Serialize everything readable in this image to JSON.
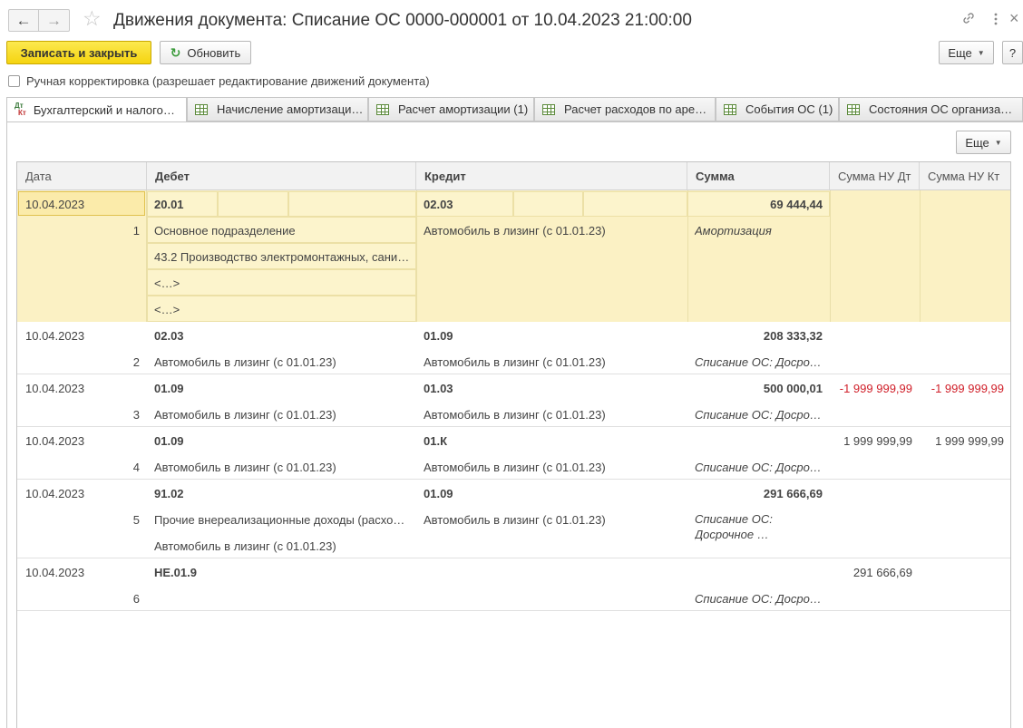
{
  "window": {
    "title": "Движения документа: Списание ОС 0000-000001 от 10.04.2023 21:00:00",
    "back_icon": "arrow-left",
    "forward_icon": "arrow-right",
    "favorite_icon": "star",
    "link_icon": "link",
    "more_icon": "vertical-ellipsis"
  },
  "toolbar": {
    "save_close_label": "Записать и закрыть",
    "refresh_label": "Обновить",
    "more_label": "Еще",
    "help_label": "?"
  },
  "manual_edit": {
    "label": "Ручная корректировка (разрешает редактирование движений документа)",
    "checked": false
  },
  "tabs": [
    {
      "label": "Бухгалтерский и налого…",
      "active": true
    },
    {
      "label": "Начисление амортизаци…"
    },
    {
      "label": "Расчет амортизации (1)"
    },
    {
      "label": "Расчет расходов по аре…"
    },
    {
      "label": "События ОС (1)"
    },
    {
      "label": "Состояния ОС организа…"
    }
  ],
  "panel": {
    "more_label": "Еще"
  },
  "grid": {
    "columns": [
      "Дата",
      "Дебет",
      "Кредит",
      "Сумма",
      "Сумма НУ Дт",
      "Сумма НУ Кт"
    ],
    "records": [
      {
        "date": "10.04.2023",
        "num": "1",
        "debit_account": "20.01",
        "debit_details": [
          "Основное подразделение",
          "43.2 Производство электромонтажных, сани…",
          "<…>",
          "<…>"
        ],
        "credit_account": "02.03",
        "credit_details": [
          "Автомобиль в лизинг (с 01.01.23)"
        ],
        "amount": "69 444,44",
        "content": "Амортизация",
        "nu_dt": "",
        "nu_kt": ""
      },
      {
        "date": "10.04.2023",
        "num": "2",
        "debit_account": "02.03",
        "debit_details": [
          "Автомобиль в лизинг (с 01.01.23)"
        ],
        "credit_account": "01.09",
        "credit_details": [
          "Автомобиль в лизинг (с 01.01.23)"
        ],
        "amount": "208 333,32",
        "content": "Списание ОС: Досро…",
        "nu_dt": "",
        "nu_kt": ""
      },
      {
        "date": "10.04.2023",
        "num": "3",
        "debit_account": "01.09",
        "debit_details": [
          "Автомобиль в лизинг (с 01.01.23)"
        ],
        "credit_account": "01.03",
        "credit_details": [
          "Автомобиль в лизинг (с 01.01.23)"
        ],
        "amount": "500 000,01",
        "content": "Списание ОС: Досро…",
        "nu_dt": "-1 999 999,99",
        "nu_kt": "-1 999 999,99"
      },
      {
        "date": "10.04.2023",
        "num": "4",
        "debit_account": "01.09",
        "debit_details": [
          "Автомобиль в лизинг (с 01.01.23)"
        ],
        "credit_account": "01.К",
        "credit_details": [
          "Автомобиль в лизинг (с 01.01.23)"
        ],
        "amount": "",
        "content": "Списание ОС: Досро…",
        "nu_dt": "1 999 999,99",
        "nu_kt": "1 999 999,99"
      },
      {
        "date": "10.04.2023",
        "num": "5",
        "debit_account": "91.02",
        "debit_details": [
          "Прочие внереализационные доходы (расхо…",
          "Автомобиль в лизинг (с 01.01.23)"
        ],
        "credit_account": "01.09",
        "credit_details": [
          "Автомобиль в лизинг (с 01.01.23)"
        ],
        "amount": "291 666,69",
        "content_lines": [
          "Списание ОС:",
          "Досрочное …"
        ],
        "nu_dt": "",
        "nu_kt": ""
      },
      {
        "date": "10.04.2023",
        "num": "6",
        "debit_account": "НЕ.01.9",
        "debit_details": [],
        "credit_account": "",
        "credit_details": [],
        "amount": "",
        "content": "Списание ОС: Досро…",
        "nu_dt": "291 666,69",
        "nu_kt": ""
      }
    ]
  },
  "colors": {
    "selected_row_bg": "#fbf1c4",
    "primary_button": "#f5d410",
    "negative_text": "#d0202a"
  }
}
